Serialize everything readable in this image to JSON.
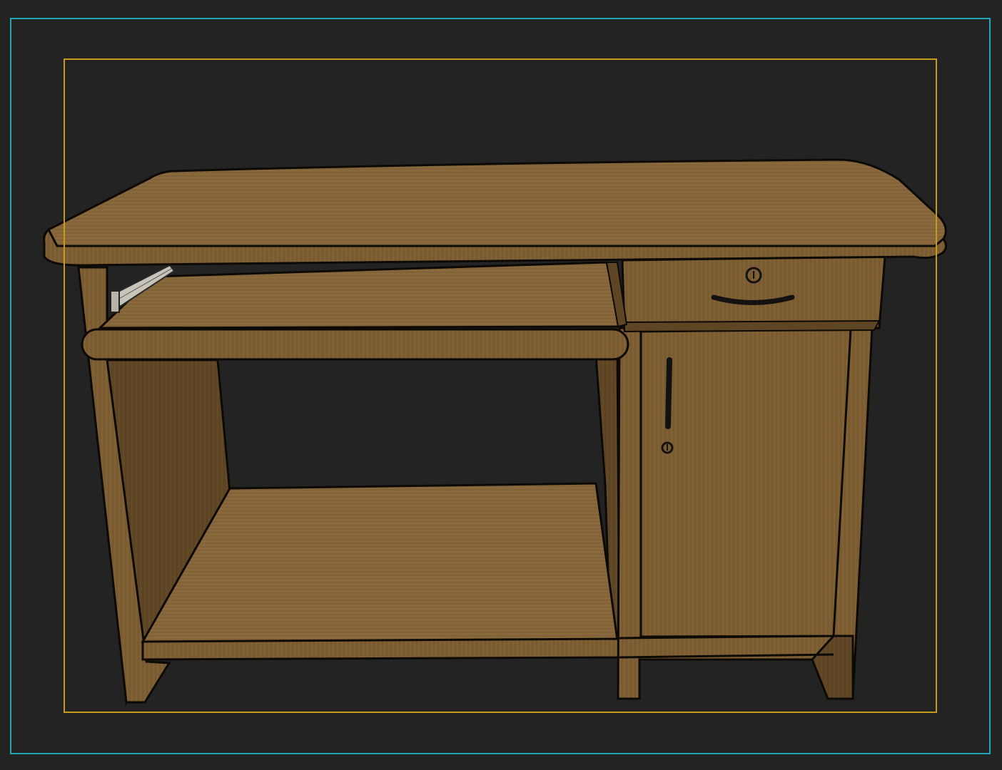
{
  "viewport": {
    "background": "#232323",
    "frame_color": "#21a6b5",
    "safe_frame_color": "#c99a18"
  },
  "model": {
    "parts": [
      "desktop-top",
      "keyboard-tray",
      "drawer",
      "cabinet-door",
      "bottom-shelf",
      "side-panels",
      "drawer-slide"
    ],
    "material_colors": {
      "light": "#8a6a3c",
      "mid": "#7a5c32",
      "dark": "#5e4524",
      "outline": "#0d0a06",
      "handle": "#141210"
    }
  }
}
